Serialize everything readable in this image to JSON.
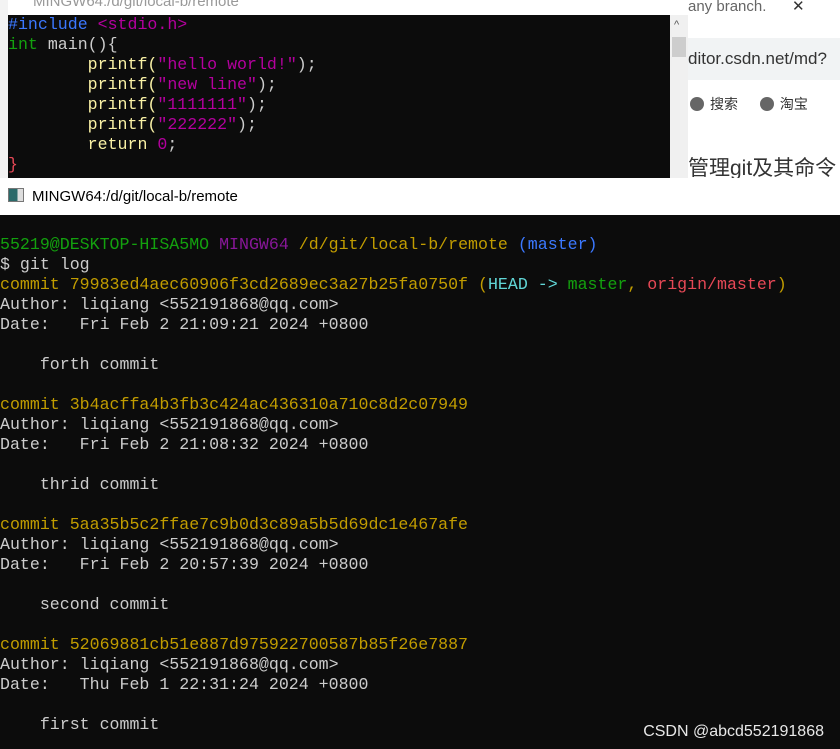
{
  "editor": {
    "title": "MINGW64:/d/git/local-b/remote",
    "code": [
      {
        "parts": [
          [
            "#include ",
            "b"
          ],
          [
            "<stdio.h>",
            "mag"
          ]
        ]
      },
      {
        "parts": [
          [
            "int",
            "g"
          ],
          [
            " main(){",
            "def"
          ]
        ]
      },
      {
        "parts": [
          [
            "        printf(",
            "wy"
          ],
          [
            "\"hello world!\"",
            "mag"
          ],
          [
            ");",
            "def"
          ]
        ]
      },
      {
        "parts": [
          [
            "        printf(",
            "wy"
          ],
          [
            "\"new line\"",
            "mag"
          ],
          [
            ");",
            "def"
          ]
        ]
      },
      {
        "parts": [
          [
            "        printf(",
            "wy"
          ],
          [
            "\"1111111\"",
            "mag"
          ],
          [
            ");",
            "def"
          ]
        ]
      },
      {
        "parts": [
          [
            "        printf(",
            "wy"
          ],
          [
            "\"222222\"",
            "mag"
          ],
          [
            ");",
            "def"
          ]
        ]
      },
      {
        "parts": [
          [
            "        return ",
            "wy"
          ],
          [
            "0",
            "mag"
          ],
          [
            ";",
            "def"
          ]
        ]
      },
      {
        "parts": [
          [
            "}",
            "r"
          ]
        ]
      }
    ]
  },
  "browser": {
    "tab_label": "any branch.",
    "close": "✕",
    "address": "ditor.csdn.net/md?",
    "bookmarks": [
      "搜索",
      "淘宝"
    ],
    "heading": "管理git及其命令"
  },
  "terminal": {
    "title": "MINGW64:/d/git/local-b/remote",
    "lines": [
      {
        "parts": [
          [
            "55219@DESKTOP-HISA5MO ",
            "g"
          ],
          [
            "MINGW64 ",
            "p"
          ],
          [
            "/d/git/local-b/remote ",
            "y"
          ],
          [
            "(master)",
            "b"
          ]
        ]
      },
      {
        "parts": [
          [
            "$ git log",
            "def"
          ]
        ]
      },
      {
        "parts": [
          [
            "commit 79983ed4aec60906f3cd2689ec3a27b25fa0750f ",
            "y"
          ],
          [
            "(",
            "y"
          ],
          [
            "HEAD -> ",
            "cy"
          ],
          [
            "master",
            "g"
          ],
          [
            ", ",
            "y"
          ],
          [
            "origin/master",
            "r"
          ],
          [
            ")",
            "y"
          ]
        ]
      },
      {
        "parts": [
          [
            "Author: liqiang <552191868@qq.com>",
            "def"
          ]
        ]
      },
      {
        "parts": [
          [
            "Date:   Fri Feb 2 21:09:21 2024 +0800",
            "def"
          ]
        ]
      },
      {
        "parts": [
          [
            "",
            "def"
          ]
        ]
      },
      {
        "parts": [
          [
            "    forth commit",
            "def"
          ]
        ]
      },
      {
        "parts": [
          [
            "",
            "def"
          ]
        ]
      },
      {
        "parts": [
          [
            "commit 3b4acffa4b3fb3c424ac436310a710c8d2c07949",
            "y"
          ]
        ]
      },
      {
        "parts": [
          [
            "Author: liqiang <552191868@qq.com>",
            "def"
          ]
        ]
      },
      {
        "parts": [
          [
            "Date:   Fri Feb 2 21:08:32 2024 +0800",
            "def"
          ]
        ]
      },
      {
        "parts": [
          [
            "",
            "def"
          ]
        ]
      },
      {
        "parts": [
          [
            "    thrid commit",
            "def"
          ]
        ]
      },
      {
        "parts": [
          [
            "",
            "def"
          ]
        ]
      },
      {
        "parts": [
          [
            "commit 5aa35b5c2ffae7c9b0d3c89a5b5d69dc1e467afe",
            "y"
          ]
        ]
      },
      {
        "parts": [
          [
            "Author: liqiang <552191868@qq.com>",
            "def"
          ]
        ]
      },
      {
        "parts": [
          [
            "Date:   Fri Feb 2 20:57:39 2024 +0800",
            "def"
          ]
        ]
      },
      {
        "parts": [
          [
            "",
            "def"
          ]
        ]
      },
      {
        "parts": [
          [
            "    second commit",
            "def"
          ]
        ]
      },
      {
        "parts": [
          [
            "",
            "def"
          ]
        ]
      },
      {
        "parts": [
          [
            "commit 52069881cb51e887d975922700587b85f26e7887",
            "y"
          ]
        ]
      },
      {
        "parts": [
          [
            "Author: liqiang <552191868@qq.com>",
            "def"
          ]
        ]
      },
      {
        "parts": [
          [
            "Date:   Thu Feb 1 22:31:24 2024 +0800",
            "def"
          ]
        ]
      },
      {
        "parts": [
          [
            "",
            "def"
          ]
        ]
      },
      {
        "parts": [
          [
            "    first commit",
            "def"
          ]
        ]
      }
    ]
  },
  "watermark": "CSDN @abcd552191868"
}
